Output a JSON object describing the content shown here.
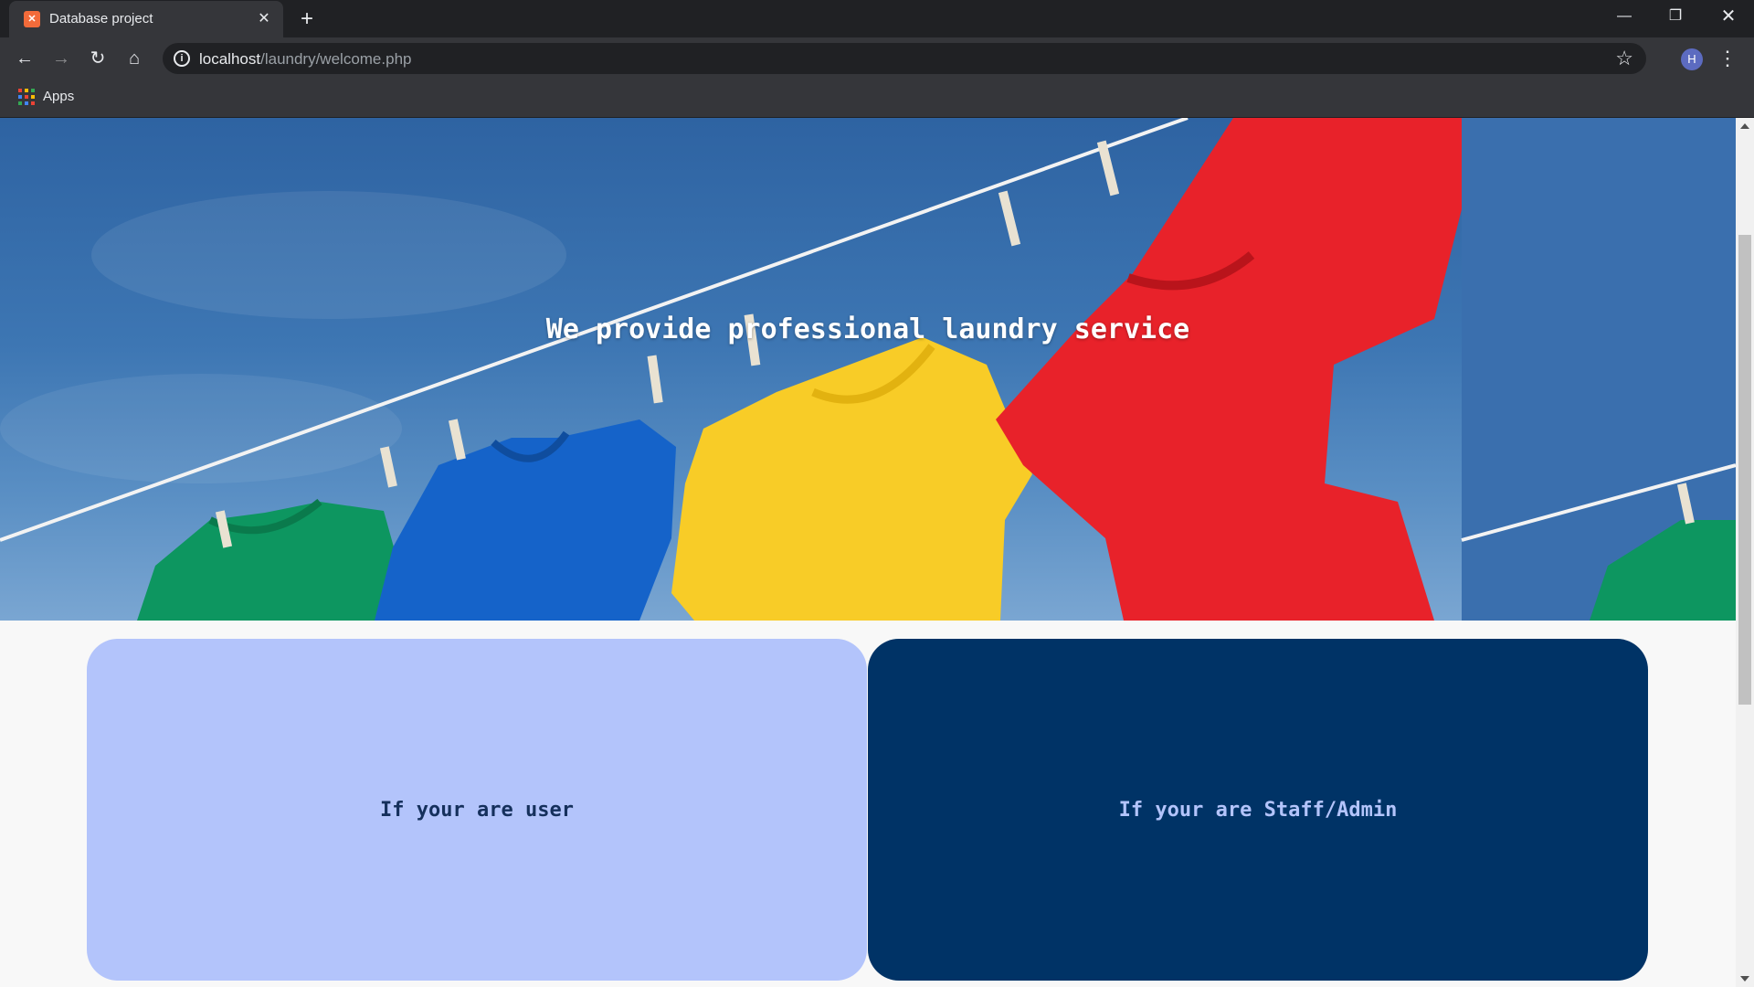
{
  "browser": {
    "tab_title": "Database project",
    "tab_favicon": "xampp-icon",
    "new_tab_label": "+",
    "url_host": "localhost",
    "url_path": "/laundry/welcome.php",
    "avatar_letter": "H",
    "bookmarks": {
      "apps_label": "Apps"
    }
  },
  "page": {
    "hero_title": "We provide professional laundry service",
    "hero_image": "shirts-on-clothesline",
    "cards": {
      "user_label": "If your are user",
      "staff_label": "If your are Staff/Admin"
    }
  },
  "colors": {
    "user_card": "#b3c4fb",
    "staff_card": "#003366"
  }
}
